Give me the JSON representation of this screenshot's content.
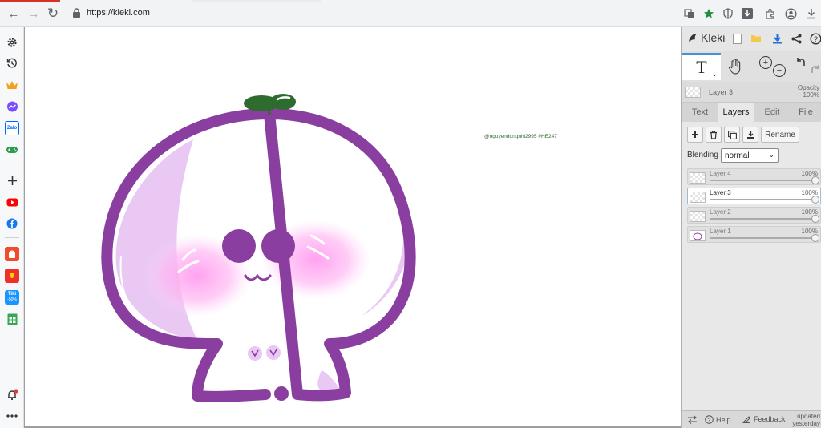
{
  "browser": {
    "url": "https://kleki.com",
    "nav": {
      "back": "←",
      "forward": "→",
      "reload": "↻"
    },
    "toolbar_icons": [
      "translate-icon",
      "star-icon",
      "shield-icon",
      "download-box-icon",
      "extensions-icon",
      "profile-icon",
      "download-icon"
    ]
  },
  "sidebar": {
    "icons": [
      "gear-icon",
      "history-icon",
      "crown-icon",
      "messenger-icon",
      "zalo-icon",
      "gamepad-icon",
      "add-icon",
      "youtube-icon",
      "facebook-icon",
      "shopee-icon",
      "lazada-icon",
      "tiki-icon",
      "sheets-icon",
      "bell-icon",
      "more-icon"
    ],
    "zalo_label": "Zalo",
    "tiki_label": "Tiki",
    "tiki_badge": "-50%"
  },
  "canvas": {
    "signature": "@nguyendongnhi2995 #HE247",
    "colors": {
      "outline": "#8a3fa0",
      "fill_light": "#e6c6f2",
      "blush": "#ffb6f0",
      "leaf": "#2e6b2e"
    }
  },
  "panel": {
    "app_name": "Kleki",
    "text_tool_glyph": "T",
    "current_layer": {
      "name": "Layer 3",
      "opacity_label": "Opacity",
      "opacity_value": "100%"
    },
    "tabs": [
      {
        "label": "Text",
        "active": false
      },
      {
        "label": "Layers",
        "active": true
      },
      {
        "label": "Edit",
        "active": false
      },
      {
        "label": "File",
        "active": false
      }
    ],
    "rename_label": "Rename",
    "blending_label": "Blending",
    "blending_value": "normal",
    "layers": [
      {
        "name": "Layer 4",
        "opacity": "100%",
        "opacity_value": 1.0,
        "active": false
      },
      {
        "name": "Layer 3",
        "opacity": "100%",
        "opacity_value": 1.0,
        "active": true
      },
      {
        "name": "Layer 2",
        "opacity": "100%",
        "opacity_value": 1.0,
        "active": false
      },
      {
        "name": "Layer 1",
        "opacity": "100%",
        "opacity_value": 1.0,
        "active": false
      }
    ],
    "footer": {
      "help": "Help",
      "feedback": "Feedback",
      "updated_line1": "updated",
      "updated_line2": "yesterday"
    }
  }
}
